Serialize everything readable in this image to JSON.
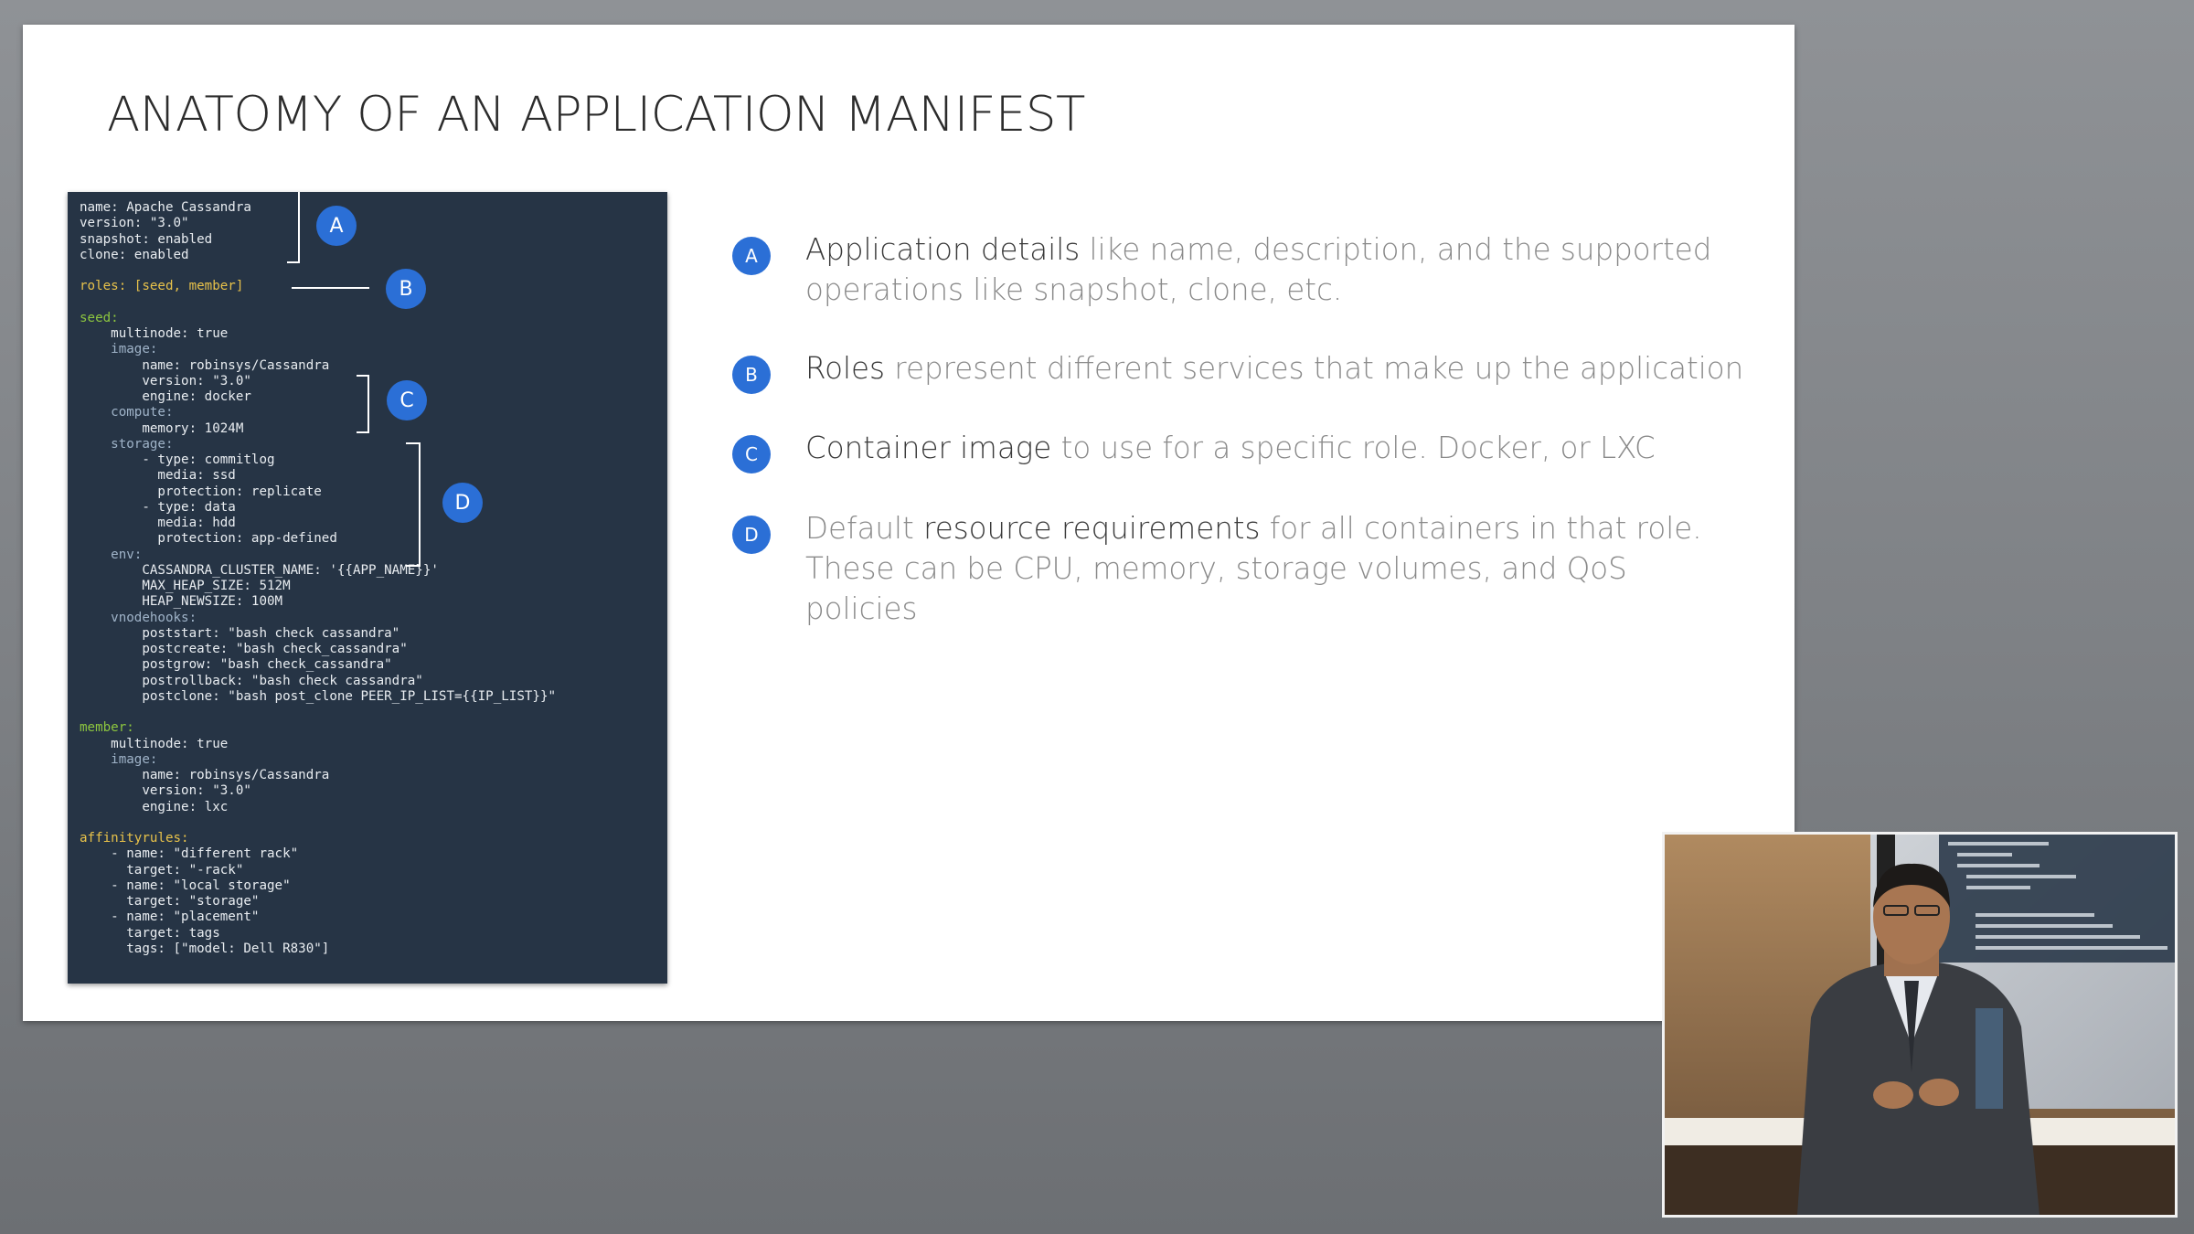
{
  "slide": {
    "title": "ANATOMY OF AN APPLICATION MANIFEST"
  },
  "code_lines": [
    {
      "text": "name: Apache Cassandra",
      "style": "plain"
    },
    {
      "text": "version: \"3.0\"",
      "style": "plain"
    },
    {
      "text": "snapshot: enabled",
      "style": "plain"
    },
    {
      "text": "clone: enabled",
      "style": "plain"
    },
    {
      "text": "",
      "style": "plain"
    },
    {
      "text": "roles: [seed, member]",
      "style": "yellow"
    },
    {
      "text": "",
      "style": "plain"
    },
    {
      "text": "seed:",
      "style": "green"
    },
    {
      "text": "    multinode: true",
      "style": "plain"
    },
    {
      "text": "    image:",
      "style": "key"
    },
    {
      "text": "        name: robinsys/Cassandra",
      "style": "plain"
    },
    {
      "text": "        version: \"3.0\"",
      "style": "plain"
    },
    {
      "text": "        engine: docker",
      "style": "plain"
    },
    {
      "text": "    compute:",
      "style": "key"
    },
    {
      "text": "        memory: 1024M",
      "style": "plain"
    },
    {
      "text": "    storage:",
      "style": "key"
    },
    {
      "text": "        - type: commitlog",
      "style": "plain"
    },
    {
      "text": "          media: ssd",
      "style": "plain"
    },
    {
      "text": "          protection: replicate",
      "style": "plain"
    },
    {
      "text": "        - type: data",
      "style": "plain"
    },
    {
      "text": "          media: hdd",
      "style": "plain"
    },
    {
      "text": "          protection: app-defined",
      "style": "plain"
    },
    {
      "text": "    env:",
      "style": "key"
    },
    {
      "text": "        CASSANDRA_CLUSTER_NAME: '{{APP_NAME}}'",
      "style": "plain"
    },
    {
      "text": "        MAX_HEAP_SIZE: 512M",
      "style": "plain"
    },
    {
      "text": "        HEAP_NEWSIZE: 100M",
      "style": "plain"
    },
    {
      "text": "    vnodehooks:",
      "style": "key"
    },
    {
      "text": "        poststart: \"bash check cassandra\"",
      "style": "plain"
    },
    {
      "text": "        postcreate: \"bash check_cassandra\"",
      "style": "plain"
    },
    {
      "text": "        postgrow: \"bash check_cassandra\"",
      "style": "plain"
    },
    {
      "text": "        postrollback: \"bash check cassandra\"",
      "style": "plain"
    },
    {
      "text": "        postclone: \"bash post_clone PEER_IP_LIST={{IP_LIST}}\"",
      "style": "plain"
    },
    {
      "text": "",
      "style": "plain"
    },
    {
      "text": "member:",
      "style": "green"
    },
    {
      "text": "    multinode: true",
      "style": "plain"
    },
    {
      "text": "    image:",
      "style": "key"
    },
    {
      "text": "        name: robinsys/Cassandra",
      "style": "plain"
    },
    {
      "text": "        version: \"3.0\"",
      "style": "plain"
    },
    {
      "text": "        engine: lxc",
      "style": "plain"
    },
    {
      "text": "",
      "style": "plain"
    },
    {
      "text": "affinityrules:",
      "style": "yellow"
    },
    {
      "text": "    - name: \"different rack\"",
      "style": "plain"
    },
    {
      "text": "      target: \"-rack\"",
      "style": "plain"
    },
    {
      "text": "    - name: \"local storage\"",
      "style": "plain"
    },
    {
      "text": "      target: \"storage\"",
      "style": "plain"
    },
    {
      "text": "    - name: \"placement\"",
      "style": "plain"
    },
    {
      "text": "      target: tags",
      "style": "plain"
    },
    {
      "text": "      tags: [\"model: Dell R830\"]",
      "style": "plain"
    }
  ],
  "code_markers": {
    "a": "A",
    "b": "B",
    "c": "C",
    "d": "D"
  },
  "bullets": [
    {
      "marker": "A",
      "lead": "Application details",
      "rest": " like name, description, and the supported operations like snapshot, clone, etc."
    },
    {
      "marker": "B",
      "lead": "Roles",
      "rest": " represent different services that make up the application"
    },
    {
      "marker": "C",
      "lead": "Container image",
      "rest": " to use for a specific role. Docker, or LXC"
    },
    {
      "marker": "D",
      "pre": "Default ",
      "lead": "resource requirements",
      "rest": " for all containers in that role. These can be CPU, memory, storage volumes, and QoS policies"
    }
  ],
  "colors": {
    "marker_blue": "#2b6fd6",
    "code_background": "#263445",
    "code_yellow": "#e8c24a",
    "code_green": "#8dc63f"
  },
  "icons": {
    "presenter_video": "presenter-video-icon"
  }
}
